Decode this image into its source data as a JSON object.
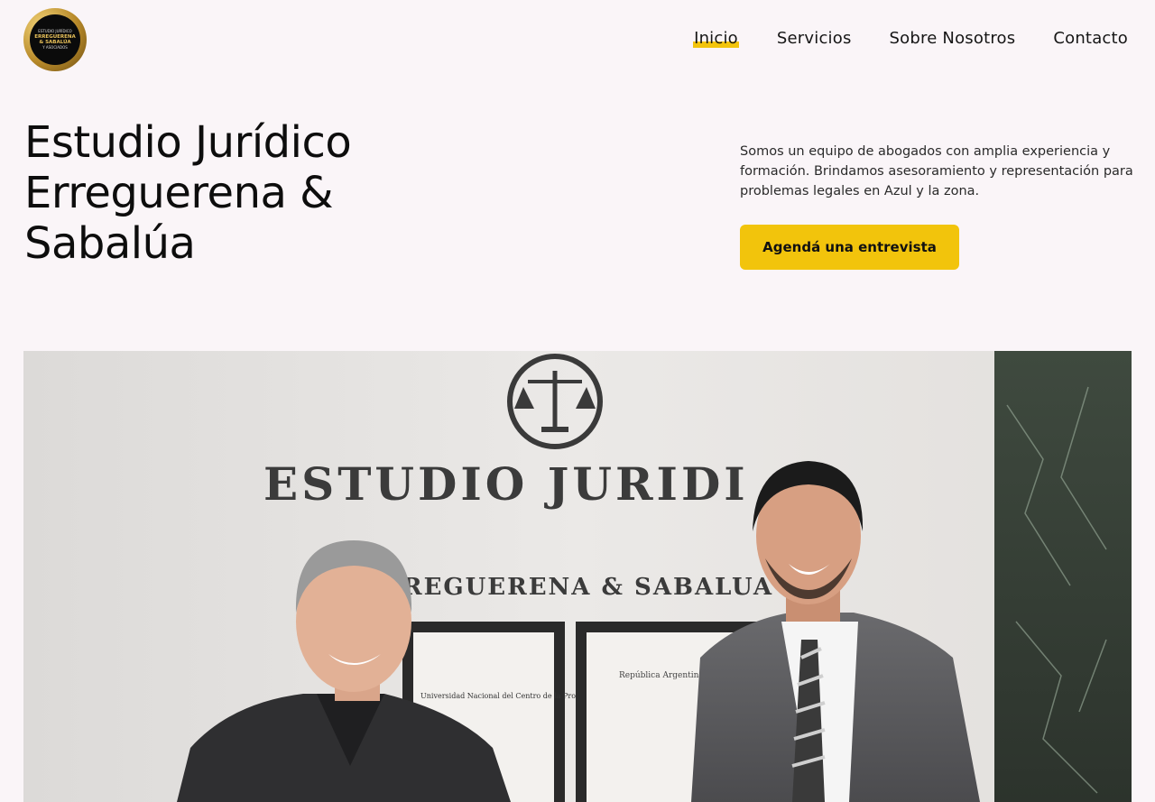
{
  "logo": {
    "line_top": "ESTUDIO JURÍDICO",
    "line_mid1": "ERREGUERENA",
    "line_mid2": "& SABALÚA",
    "line_bot": "Y ASOCIADOS"
  },
  "nav": {
    "items": [
      {
        "label": "Inicio",
        "active": true
      },
      {
        "label": "Servicios",
        "active": false
      },
      {
        "label": "Sobre Nosotros",
        "active": false
      },
      {
        "label": "Contacto",
        "active": false
      }
    ]
  },
  "hero": {
    "title_line1": "Estudio Jurídico",
    "title_line2": "Erreguerena &",
    "title_line3": "Sabalúa",
    "description": "Somos un equipo de abogados con amplia experiencia y formación. Brindamos asesoramiento y representación para problemas legales en Azul y la zona.",
    "cta_label": "Agendá una entrevista"
  },
  "photo": {
    "wall_sign_line1": "ESTUDIO JURIDI",
    "wall_sign_line2": "REGUERENA & SABALUA",
    "diploma_left_text": "Universidad Nacional del Centro de la Provincia de Buenos Aires",
    "diploma_right_text": "República Argentina",
    "icon": "scales-of-justice-icon"
  },
  "colors": {
    "accent": "#f2c40c",
    "background": "#faf5f8",
    "text": "#111111"
  }
}
